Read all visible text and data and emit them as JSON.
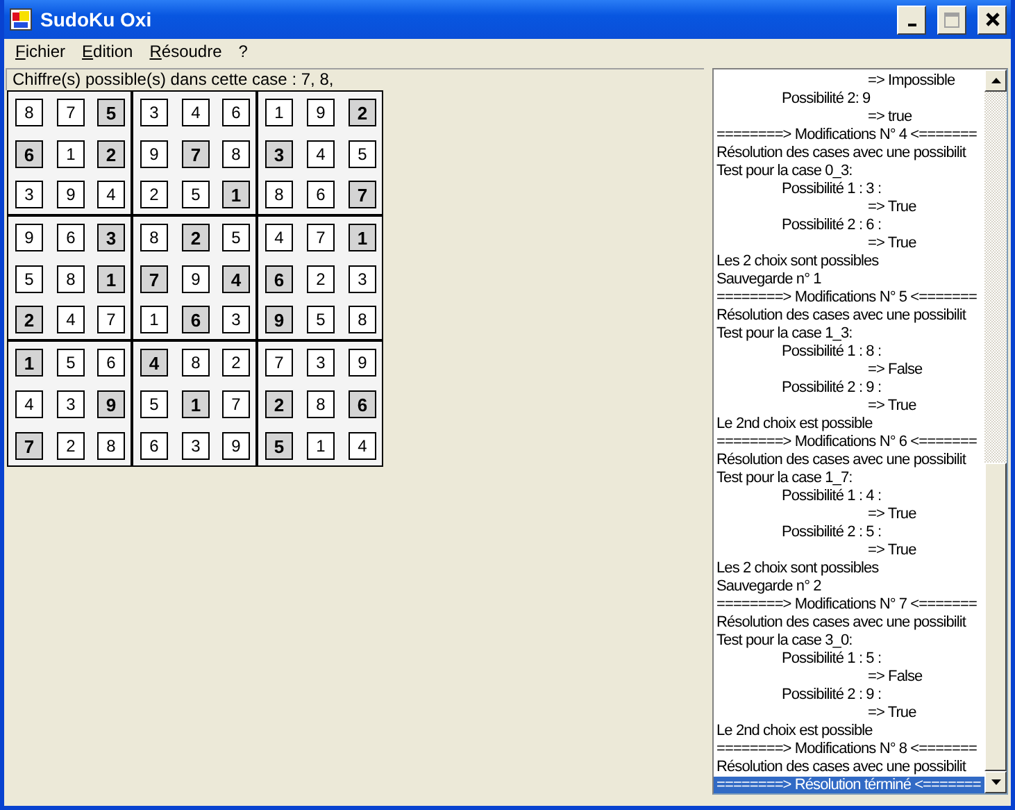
{
  "window": {
    "title": "SudoKu Oxi"
  },
  "menu": [
    {
      "label": "Fichier",
      "mnemonic": true
    },
    {
      "label": "Edition",
      "mnemonic": true
    },
    {
      "label": "Résoudre",
      "mnemonic": true
    },
    {
      "label": "?",
      "mnemonic": false
    }
  ],
  "hint": "Chiffre(s) possible(s) dans cette case : 7, 8,",
  "grid": [
    [
      {
        "value": "8",
        "given": false
      },
      {
        "value": "7",
        "given": false
      },
      {
        "value": "5",
        "given": true
      },
      {
        "value": "3",
        "given": false
      },
      {
        "value": "4",
        "given": false
      },
      {
        "value": "6",
        "given": false
      },
      {
        "value": "1",
        "given": false
      },
      {
        "value": "9",
        "given": false
      },
      {
        "value": "2",
        "given": true
      }
    ],
    [
      {
        "value": "6",
        "given": true
      },
      {
        "value": "1",
        "given": false
      },
      {
        "value": "2",
        "given": true
      },
      {
        "value": "9",
        "given": false
      },
      {
        "value": "7",
        "given": true
      },
      {
        "value": "8",
        "given": false
      },
      {
        "value": "3",
        "given": true
      },
      {
        "value": "4",
        "given": false
      },
      {
        "value": "5",
        "given": false
      }
    ],
    [
      {
        "value": "3",
        "given": false
      },
      {
        "value": "9",
        "given": false
      },
      {
        "value": "4",
        "given": false
      },
      {
        "value": "2",
        "given": false
      },
      {
        "value": "5",
        "given": false
      },
      {
        "value": "1",
        "given": true
      },
      {
        "value": "8",
        "given": false
      },
      {
        "value": "6",
        "given": false
      },
      {
        "value": "7",
        "given": true
      }
    ],
    [
      {
        "value": "9",
        "given": false
      },
      {
        "value": "6",
        "given": false
      },
      {
        "value": "3",
        "given": true
      },
      {
        "value": "8",
        "given": false
      },
      {
        "value": "2",
        "given": true
      },
      {
        "value": "5",
        "given": false
      },
      {
        "value": "4",
        "given": false
      },
      {
        "value": "7",
        "given": false
      },
      {
        "value": "1",
        "given": true
      }
    ],
    [
      {
        "value": "5",
        "given": false
      },
      {
        "value": "8",
        "given": false
      },
      {
        "value": "1",
        "given": true
      },
      {
        "value": "7",
        "given": true
      },
      {
        "value": "9",
        "given": false
      },
      {
        "value": "4",
        "given": true
      },
      {
        "value": "6",
        "given": true
      },
      {
        "value": "2",
        "given": false
      },
      {
        "value": "3",
        "given": false
      }
    ],
    [
      {
        "value": "2",
        "given": true
      },
      {
        "value": "4",
        "given": false
      },
      {
        "value": "7",
        "given": false
      },
      {
        "value": "1",
        "given": false
      },
      {
        "value": "6",
        "given": true
      },
      {
        "value": "3",
        "given": false
      },
      {
        "value": "9",
        "given": true
      },
      {
        "value": "5",
        "given": false
      },
      {
        "value": "8",
        "given": false
      }
    ],
    [
      {
        "value": "1",
        "given": true
      },
      {
        "value": "5",
        "given": false
      },
      {
        "value": "6",
        "given": false
      },
      {
        "value": "4",
        "given": true
      },
      {
        "value": "8",
        "given": false
      },
      {
        "value": "2",
        "given": false
      },
      {
        "value": "7",
        "given": false
      },
      {
        "value": "3",
        "given": false
      },
      {
        "value": "9",
        "given": false
      }
    ],
    [
      {
        "value": "4",
        "given": false
      },
      {
        "value": "3",
        "given": false
      },
      {
        "value": "9",
        "given": true
      },
      {
        "value": "5",
        "given": false
      },
      {
        "value": "1",
        "given": true
      },
      {
        "value": "7",
        "given": false
      },
      {
        "value": "2",
        "given": true
      },
      {
        "value": "8",
        "given": false
      },
      {
        "value": "6",
        "given": true
      }
    ],
    [
      {
        "value": "7",
        "given": true
      },
      {
        "value": "2",
        "given": false
      },
      {
        "value": "8",
        "given": false
      },
      {
        "value": "6",
        "given": false
      },
      {
        "value": "3",
        "given": false
      },
      {
        "value": "9",
        "given": false
      },
      {
        "value": "5",
        "given": true
      },
      {
        "value": "1",
        "given": false
      },
      {
        "value": "4",
        "given": false
      }
    ]
  ],
  "log": [
    {
      "text": "=> Impossible",
      "kind": "result",
      "selected": false
    },
    {
      "text": "Possibilité 2: 9",
      "kind": "option",
      "selected": false
    },
    {
      "text": "=> true",
      "kind": "result",
      "selected": false
    },
    {
      "text": "========> Modifications N° 4 <=======",
      "kind": "line",
      "selected": false
    },
    {
      "text": "Résolution des cases avec une possibilit",
      "kind": "line",
      "selected": false
    },
    {
      "text": "Test pour la case 0_3:",
      "kind": "line",
      "selected": false
    },
    {
      "text": "Possibilité 1 : 3 :",
      "kind": "option",
      "selected": false
    },
    {
      "text": "=> True",
      "kind": "result",
      "selected": false
    },
    {
      "text": "Possibilité 2 : 6 :",
      "kind": "option",
      "selected": false
    },
    {
      "text": "=> True",
      "kind": "result",
      "selected": false
    },
    {
      "text": "Les 2 choix sont possibles",
      "kind": "line",
      "selected": false
    },
    {
      "text": "Sauvegarde n° 1",
      "kind": "line",
      "selected": false
    },
    {
      "text": "========> Modifications N° 5 <=======",
      "kind": "line",
      "selected": false
    },
    {
      "text": "Résolution des cases avec une possibilit",
      "kind": "line",
      "selected": false
    },
    {
      "text": "Test pour la case 1_3:",
      "kind": "line",
      "selected": false
    },
    {
      "text": "Possibilité 1 : 8 :",
      "kind": "option",
      "selected": false
    },
    {
      "text": "=> False",
      "kind": "result",
      "selected": false
    },
    {
      "text": "Possibilité 2 : 9 :",
      "kind": "option",
      "selected": false
    },
    {
      "text": "=> True",
      "kind": "result",
      "selected": false
    },
    {
      "text": "Le 2nd choix est possible",
      "kind": "line",
      "selected": false
    },
    {
      "text": "========> Modifications N° 6 <=======",
      "kind": "line",
      "selected": false
    },
    {
      "text": "Résolution des cases avec une possibilit",
      "kind": "line",
      "selected": false
    },
    {
      "text": "Test pour la case 1_7:",
      "kind": "line",
      "selected": false
    },
    {
      "text": "Possibilité 1 : 4 :",
      "kind": "option",
      "selected": false
    },
    {
      "text": "=> True",
      "kind": "result",
      "selected": false
    },
    {
      "text": "Possibilité 2 : 5 :",
      "kind": "option",
      "selected": false
    },
    {
      "text": "=> True",
      "kind": "result",
      "selected": false
    },
    {
      "text": "Les 2 choix sont possibles",
      "kind": "line",
      "selected": false
    },
    {
      "text": "Sauvegarde n° 2",
      "kind": "line",
      "selected": false
    },
    {
      "text": "========> Modifications N° 7 <=======",
      "kind": "line",
      "selected": false
    },
    {
      "text": "Résolution des cases avec une possibilit",
      "kind": "line",
      "selected": false
    },
    {
      "text": "Test pour la case 3_0:",
      "kind": "line",
      "selected": false
    },
    {
      "text": "Possibilité 1 : 5 :",
      "kind": "option",
      "selected": false
    },
    {
      "text": "=> False",
      "kind": "result",
      "selected": false
    },
    {
      "text": "Possibilité 2 : 9 :",
      "kind": "option",
      "selected": false
    },
    {
      "text": "=> True",
      "kind": "result",
      "selected": false
    },
    {
      "text": "Le 2nd choix est possible",
      "kind": "line",
      "selected": false
    },
    {
      "text": "========> Modifications N° 8 <=======",
      "kind": "line",
      "selected": false
    },
    {
      "text": "Résolution des cases avec une possibilit",
      "kind": "line",
      "selected": false
    },
    {
      "text": "========> Résolution términé <=======",
      "kind": "line",
      "selected": true
    }
  ]
}
